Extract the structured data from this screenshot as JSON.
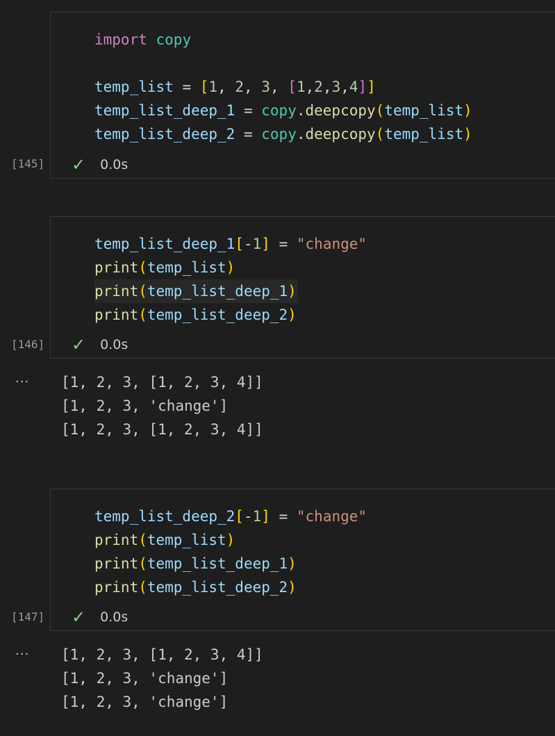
{
  "theme": {
    "background": "#1e1e1e",
    "cell_border": "#383838",
    "success_check_color": "#89d185"
  },
  "cells": [
    {
      "execution_count": "[145]",
      "status_icon": "check-icon",
      "duration": "0.0s",
      "code_lines": [
        "import copy",
        "",
        "temp_list = [1, 2, 3, [1,2,3,4]]",
        "temp_list_deep_1 = copy.deepcopy(temp_list)",
        "temp_list_deep_2 = copy.deepcopy(temp_list)"
      ],
      "output_lines": []
    },
    {
      "execution_count": "[146]",
      "status_icon": "check-icon",
      "duration": "0.0s",
      "code_lines": [
        "temp_list_deep_1[-1] = \"change\"",
        "print(temp_list)",
        "print(temp_list_deep_1)",
        "print(temp_list_deep_2)"
      ],
      "output_marker": "...",
      "output_lines": [
        "[1, 2, 3, [1, 2, 3, 4]]",
        "[1, 2, 3, 'change']",
        "[1, 2, 3, [1, 2, 3, 4]]"
      ]
    },
    {
      "execution_count": "[147]",
      "status_icon": "check-icon",
      "duration": "0.0s",
      "code_lines": [
        "temp_list_deep_2[-1] = \"change\"",
        "print(temp_list)",
        "print(temp_list_deep_1)",
        "print(temp_list_deep_2)"
      ],
      "output_marker": "...",
      "output_lines": [
        "[1, 2, 3, [1, 2, 3, 4]]",
        "[1, 2, 3, 'change']",
        "[1, 2, 3, 'change']"
      ]
    }
  ]
}
